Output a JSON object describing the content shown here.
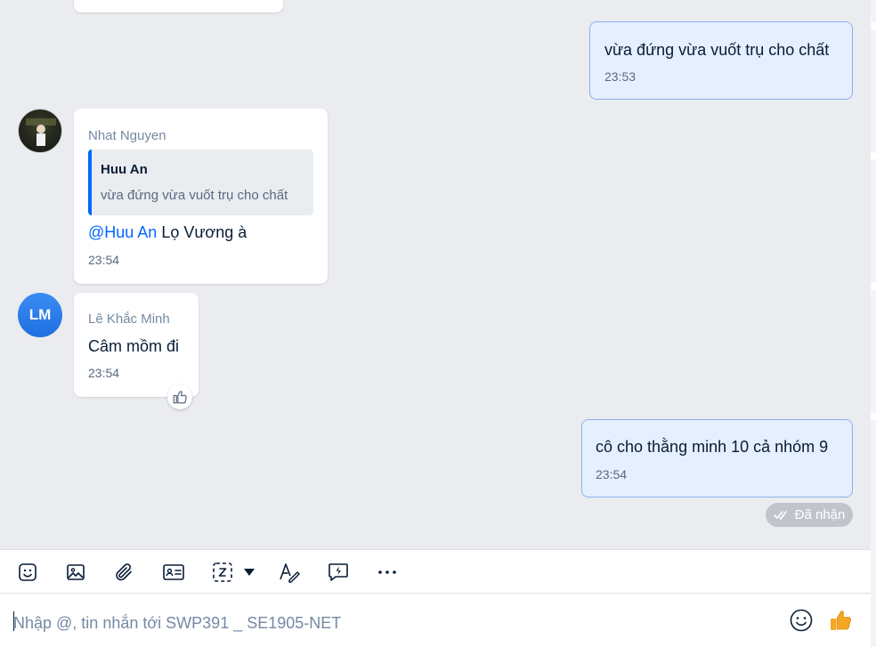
{
  "conversation": {
    "name": "SWP391 _ SE1905-NET"
  },
  "messages": [
    {
      "text": "vừa đứng vừa vuốt trụ cho chất",
      "time": "23:53"
    },
    {
      "sender": "Nhat Nguyen",
      "quote": {
        "name": "Huu An",
        "text": "vừa đứng vừa vuốt trụ cho chất"
      },
      "mention": "@Huu An",
      "text": " Lọ Vương à",
      "time": "23:54"
    },
    {
      "avatar_initials": "LM",
      "sender": "Lê Khắc Minh",
      "text": "Câm mồm đi",
      "time": "23:54",
      "reaction_icon": "thumbs-up-outline-icon"
    },
    {
      "text": "cô cho thằng minh 10 cả nhóm 9",
      "time": "23:54"
    }
  ],
  "status": {
    "label": "Đã nhận",
    "icon": "double-check-icon"
  },
  "toolbar": {
    "icons": [
      "sticker-icon",
      "image-icon",
      "attachment-icon",
      "contact-card-icon",
      "screenshot-icon",
      "chevron-down-icon",
      "text-format-icon",
      "quick-message-icon",
      "more-icon"
    ]
  },
  "composer": {
    "placeholder": "Nhập @, tin nhắn tới SWP391 _ SE1905-NET",
    "value": "",
    "emoji_icon": "emoji-icon",
    "send_icon": "thumbs-up-icon"
  },
  "colors": {
    "accent": "#0068ff",
    "outgoing_bubble": "#e5efff",
    "background": "#ebecf0",
    "thumb": "#f5a623"
  }
}
